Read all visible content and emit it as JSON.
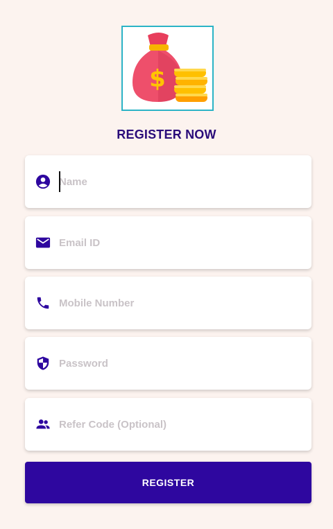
{
  "header": {
    "title": "REGISTER NOW",
    "logo_icon": "money-bag-with-coins-icon"
  },
  "form": {
    "fields": [
      {
        "icon": "account-circle-icon",
        "placeholder": "Name",
        "value": ""
      },
      {
        "icon": "email-icon",
        "placeholder": "Email ID",
        "value": ""
      },
      {
        "icon": "phone-icon",
        "placeholder": "Mobile Number",
        "value": ""
      },
      {
        "icon": "shield-icon",
        "placeholder": "Password",
        "value": ""
      },
      {
        "icon": "people-icon",
        "placeholder": "Refer Code (Optional)",
        "value": ""
      }
    ],
    "submit_label": "REGISTER"
  },
  "colors": {
    "background": "#fcf3ef",
    "accent": "#2e079f",
    "title": "#2a0c7a",
    "logo_border": "#2bb3c6"
  }
}
